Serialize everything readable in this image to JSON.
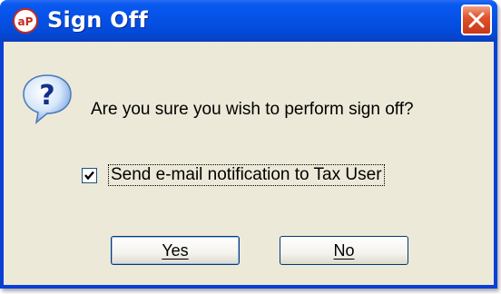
{
  "window": {
    "title": "Sign Off",
    "app_icon": "ap-logo-icon",
    "close_icon": "close-icon"
  },
  "dialog": {
    "icon": "question-icon",
    "message": "Are you sure you wish to perform sign off?",
    "checkbox": {
      "label": "Send e-mail notification to Tax User",
      "checked": true
    },
    "buttons": {
      "yes_label": "Yes",
      "no_label": "No"
    }
  },
  "colors": {
    "titlebar": "#0551e6",
    "client": "#ece9d8",
    "close": "#e0532c"
  }
}
